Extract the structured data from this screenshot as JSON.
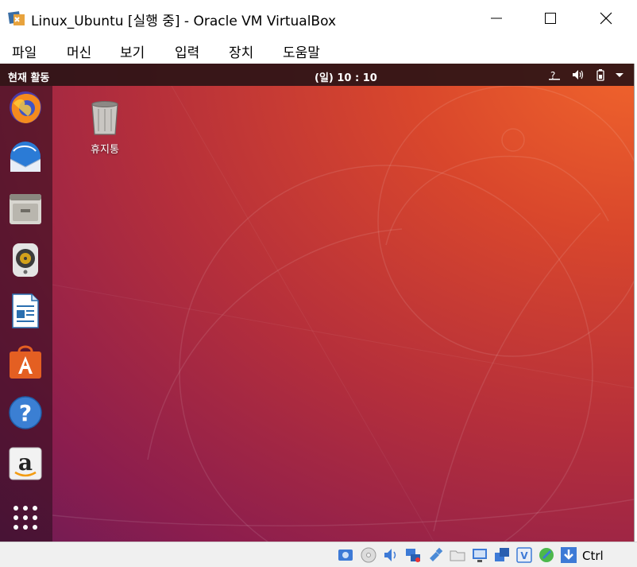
{
  "window": {
    "title": "Linux_Ubuntu [실행 중] - Oracle VM VirtualBox",
    "app_icon": "virtualbox-icon",
    "controls": [
      "minimize-icon",
      "maximize-icon",
      "close-icon"
    ]
  },
  "menubar": {
    "items": [
      "파일",
      "머신",
      "보기",
      "입력",
      "장치",
      "도움말"
    ]
  },
  "guest": {
    "toppanel": {
      "activities": "현재 활동",
      "clock": "(일) 10 : 10",
      "system_icons": [
        "network-unknown-icon",
        "volume-icon",
        "battery-icon",
        "dropdown-arrow-icon"
      ]
    },
    "dock": {
      "apps": [
        "firefox-icon",
        "thunderbird-icon",
        "files-icon",
        "rhythmbox-icon",
        "libreoffice-writer-icon",
        "software-center-icon",
        "help-icon",
        "amazon-icon",
        "show-applications-icon"
      ]
    },
    "desktop": {
      "trash_label": "휴지통"
    }
  },
  "statusbar": {
    "icons": [
      "hard-disk-icon",
      "optical-drive-icon",
      "audio-icon",
      "network-icon",
      "usb-icon",
      "shared-folders-icon",
      "display-icon",
      "video-capture-icon",
      "vbox-extension-icon",
      "mouse-integration-icon",
      "download-icon"
    ],
    "host_key": "Ctrl"
  },
  "colors": {
    "panel": "#2d1416",
    "wallpaper_light": "#f0642c",
    "wallpaper_dark": "#6e1c55"
  }
}
